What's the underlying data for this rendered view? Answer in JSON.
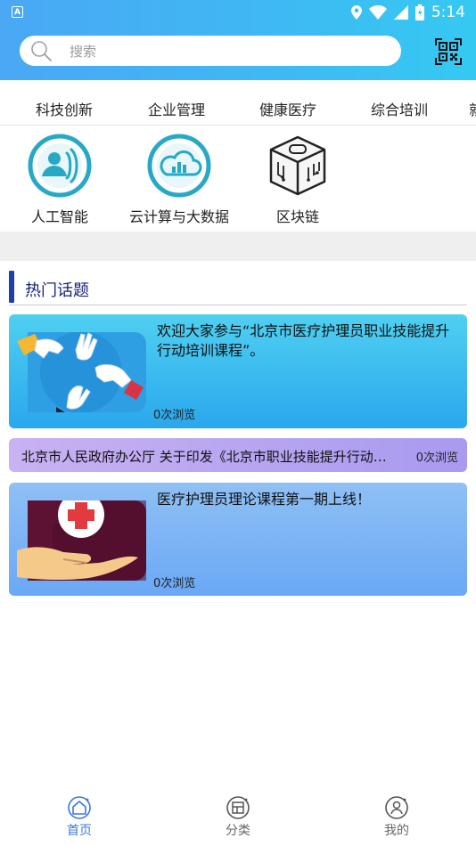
{
  "status_bar": {
    "notification_glyph": "A",
    "time": "5:14",
    "icons": [
      "location-icon",
      "wifi-icon",
      "signal-icon",
      "battery-icon"
    ]
  },
  "search": {
    "placeholder": "搜索"
  },
  "tabs": [
    "科技创新",
    "企业管理",
    "健康医疗",
    "综合培训",
    "就"
  ],
  "categories": [
    {
      "label": "人工智能",
      "icon": "ai-person-icon"
    },
    {
      "label": "云计算与大数据",
      "icon": "cloud-data-icon"
    },
    {
      "label": "区块链",
      "icon": "blockchain-cube-icon"
    }
  ],
  "section": {
    "title": "热门话题"
  },
  "topics": [
    {
      "title": "欢迎大家参与“北京市医疗护理员职业技能提升行动培训课程”。",
      "views": "0次浏览"
    },
    {
      "title": "北京市人民政府办公厅 关于印发《北京市职业技能提升行动…",
      "views": "0次浏览"
    },
    {
      "title": "医疗护理员理论课程第一期上线！",
      "views": "0次浏览"
    }
  ],
  "bottom_nav": [
    {
      "label": "首页",
      "active": true
    },
    {
      "label": "分类",
      "active": false
    },
    {
      "label": "我的",
      "active": false
    }
  ],
  "colors": {
    "accent": "#3a78e0",
    "header_start": "#4aa8f4",
    "header_end": "#35c9f2",
    "section_bar": "#1f3fa6"
  }
}
